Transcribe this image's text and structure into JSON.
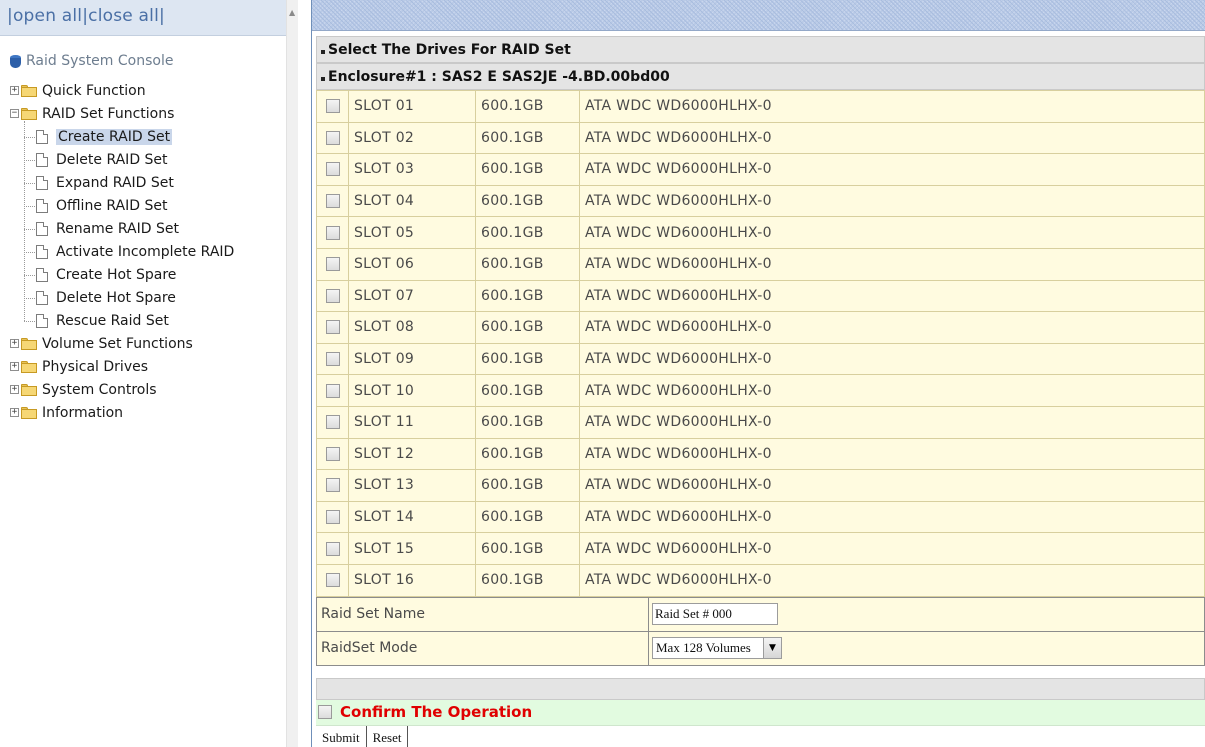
{
  "left_frame": {
    "links_prefix": "|",
    "open_all": "open all",
    "separator": "|",
    "close_all": "close all",
    "links_suffix": "|",
    "tree": {
      "root": "Raid System Console",
      "items": [
        {
          "label": "Quick Function",
          "expanded": false
        },
        {
          "label": "RAID Set Functions",
          "expanded": true,
          "children": [
            "Create RAID Set",
            "Delete RAID Set",
            "Expand RAID Set",
            "Offline RAID Set",
            "Rename RAID Set",
            "Activate Incomplete RAID",
            "Create Hot Spare",
            "Delete Hot Spare",
            "Rescue Raid Set"
          ],
          "selected_child": "Create RAID Set"
        },
        {
          "label": "Volume Set Functions",
          "expanded": false
        },
        {
          "label": "Physical Drives",
          "expanded": false
        },
        {
          "label": "System Controls",
          "expanded": false
        },
        {
          "label": "Information",
          "expanded": false
        }
      ]
    }
  },
  "main": {
    "section_title": "Select The Drives For RAID Set",
    "enclosure_title": "Enclosure#1 : SAS2 E SAS2JE -4.BD.00bd00",
    "drives": [
      {
        "slot": "SLOT 01",
        "capacity": "600.1GB",
        "model": "ATA WDC WD6000HLHX-0",
        "checked": false
      },
      {
        "slot": "SLOT 02",
        "capacity": "600.1GB",
        "model": "ATA WDC WD6000HLHX-0",
        "checked": false
      },
      {
        "slot": "SLOT 03",
        "capacity": "600.1GB",
        "model": "ATA WDC WD6000HLHX-0",
        "checked": false
      },
      {
        "slot": "SLOT 04",
        "capacity": "600.1GB",
        "model": "ATA WDC WD6000HLHX-0",
        "checked": false
      },
      {
        "slot": "SLOT 05",
        "capacity": "600.1GB",
        "model": "ATA WDC WD6000HLHX-0",
        "checked": false
      },
      {
        "slot": "SLOT 06",
        "capacity": "600.1GB",
        "model": "ATA WDC WD6000HLHX-0",
        "checked": false
      },
      {
        "slot": "SLOT 07",
        "capacity": "600.1GB",
        "model": "ATA WDC WD6000HLHX-0",
        "checked": false
      },
      {
        "slot": "SLOT 08",
        "capacity": "600.1GB",
        "model": "ATA WDC WD6000HLHX-0",
        "checked": false
      },
      {
        "slot": "SLOT 09",
        "capacity": "600.1GB",
        "model": "ATA WDC WD6000HLHX-0",
        "checked": false
      },
      {
        "slot": "SLOT 10",
        "capacity": "600.1GB",
        "model": "ATA WDC WD6000HLHX-0",
        "checked": false
      },
      {
        "slot": "SLOT 11",
        "capacity": "600.1GB",
        "model": "ATA WDC WD6000HLHX-0",
        "checked": false
      },
      {
        "slot": "SLOT 12",
        "capacity": "600.1GB",
        "model": "ATA WDC WD6000HLHX-0",
        "checked": false
      },
      {
        "slot": "SLOT 13",
        "capacity": "600.1GB",
        "model": "ATA WDC WD6000HLHX-0",
        "checked": false
      },
      {
        "slot": "SLOT 14",
        "capacity": "600.1GB",
        "model": "ATA WDC WD6000HLHX-0",
        "checked": false
      },
      {
        "slot": "SLOT 15",
        "capacity": "600.1GB",
        "model": "ATA WDC WD6000HLHX-0",
        "checked": false
      },
      {
        "slot": "SLOT 16",
        "capacity": "600.1GB",
        "model": "ATA WDC WD6000HLHX-0",
        "checked": false
      }
    ],
    "raid_set_name_label": "Raid Set Name",
    "raid_set_name_value": "Raid Set # 000",
    "raidset_mode_label": "RaidSet Mode",
    "raidset_mode_value": "Max 128 Volumes",
    "confirm_label": "Confirm The Operation",
    "submit_label": "Submit",
    "reset_label": "Reset"
  },
  "colors": {
    "row_background": "#fffbe0",
    "confirm_background": "#e2fbe0",
    "confirm_text": "#e00000",
    "header_background": "#e4e4e4",
    "selected_tree_item": "#c9d6ea"
  },
  "icons": {
    "root": "database-icon",
    "folder": "folder-icon",
    "page": "page-icon",
    "expand": "plus-box-icon",
    "collapse": "minus-box-icon"
  }
}
